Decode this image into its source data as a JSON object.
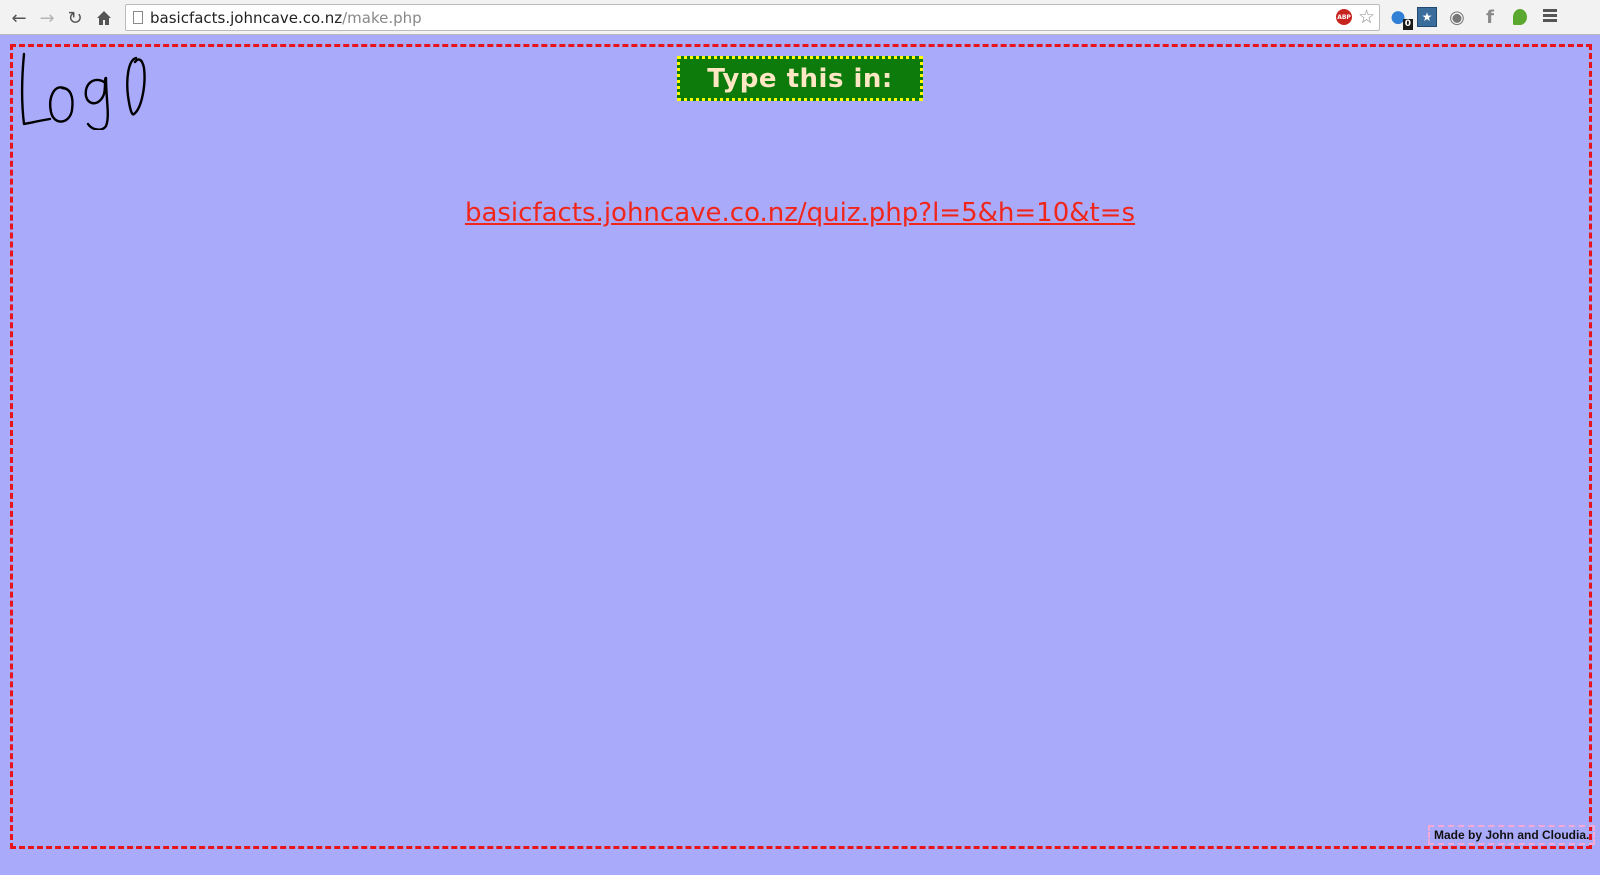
{
  "browser": {
    "url_host": "basicfacts.johncave.co.nz",
    "url_path": "/make.php",
    "back_icon": "back-arrow-icon",
    "forward_icon": "forward-arrow-icon",
    "reload_icon": "reload-icon",
    "home_icon": "home-icon",
    "abp_label": "ABP",
    "ghost_badge": "0"
  },
  "page": {
    "background_color": "#aaaafa",
    "frame_border_color": "#e8141c",
    "logo_text": "Logo",
    "heading": "Type this in:",
    "heading_bg_color": "#0c7b0c",
    "heading_border_color": "#ffff00",
    "quiz_url": "basicfacts.johncave.co.nz/quiz.php?l=5&h=10&t=s",
    "link_color": "#f0261b",
    "credits": "Made by John and Cloudia."
  }
}
